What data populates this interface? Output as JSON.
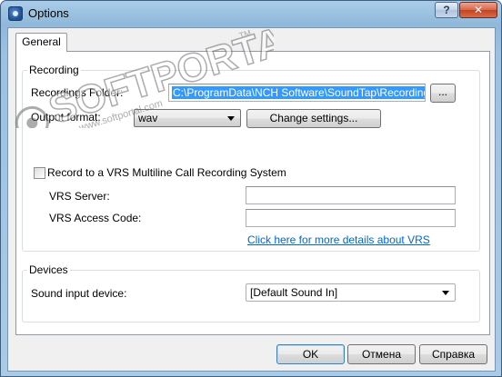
{
  "window": {
    "title": "Options",
    "help_button": "?",
    "close_button": "✕"
  },
  "tabs": [
    {
      "label": "General",
      "active": true
    }
  ],
  "recording": {
    "group_label": "Recording",
    "folder_label": "Recordings Folder:",
    "folder_value": "C:\\ProgramData\\NCH Software\\SoundTap\\Recordings",
    "browse_label": "...",
    "format_label": "Output format:",
    "format_value": "wav",
    "change_settings_label": "Change settings...",
    "vrs_checkbox_label": "Record to a VRS Multiline Call Recording System",
    "vrs_checked": false,
    "vrs_server_label": "VRS Server:",
    "vrs_server_value": "",
    "vrs_code_label": "VRS Access Code:",
    "vrs_code_value": "",
    "vrs_link": "Click here for more details about VRS"
  },
  "devices": {
    "group_label": "Devices",
    "input_label": "Sound input device:",
    "input_value": "[Default Sound In]"
  },
  "footer": {
    "ok": "OK",
    "cancel": "Отмена",
    "help": "Справка"
  },
  "watermark": {
    "main": "SOFTPORTAL",
    "url": "www.softportal.com",
    "tm": "TM"
  },
  "colors": {
    "selection": "#3399ff",
    "link": "#0066cc",
    "close_button": "#c3431f"
  }
}
